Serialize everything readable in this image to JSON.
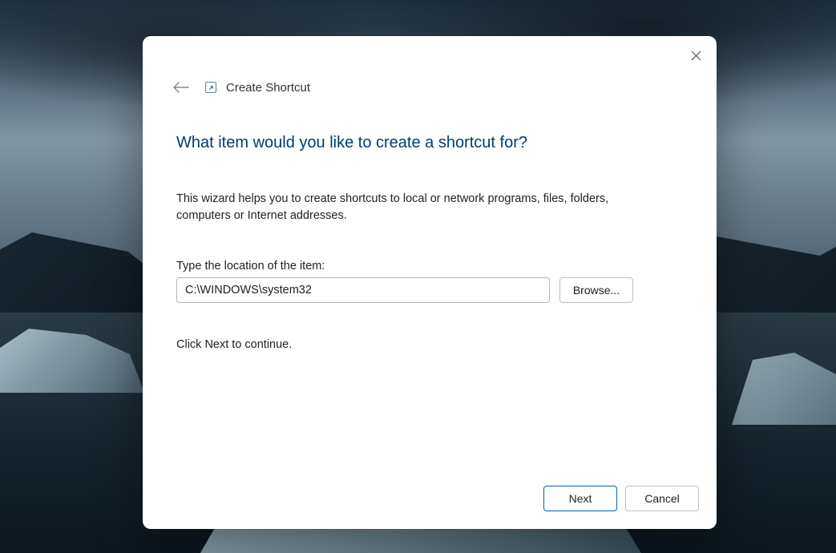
{
  "dialog": {
    "title": "Create Shortcut",
    "heading": "What item would you like to create a shortcut for?",
    "description": "This wizard helps you to create shortcuts to local or network programs, files, folders, computers or Internet addresses.",
    "input_label": "Type the location of the item:",
    "input_value": "C:\\WINDOWS\\system32",
    "browse_label": "Browse...",
    "continue_text": "Click Next to continue.",
    "next_label": "Next",
    "cancel_label": "Cancel"
  }
}
